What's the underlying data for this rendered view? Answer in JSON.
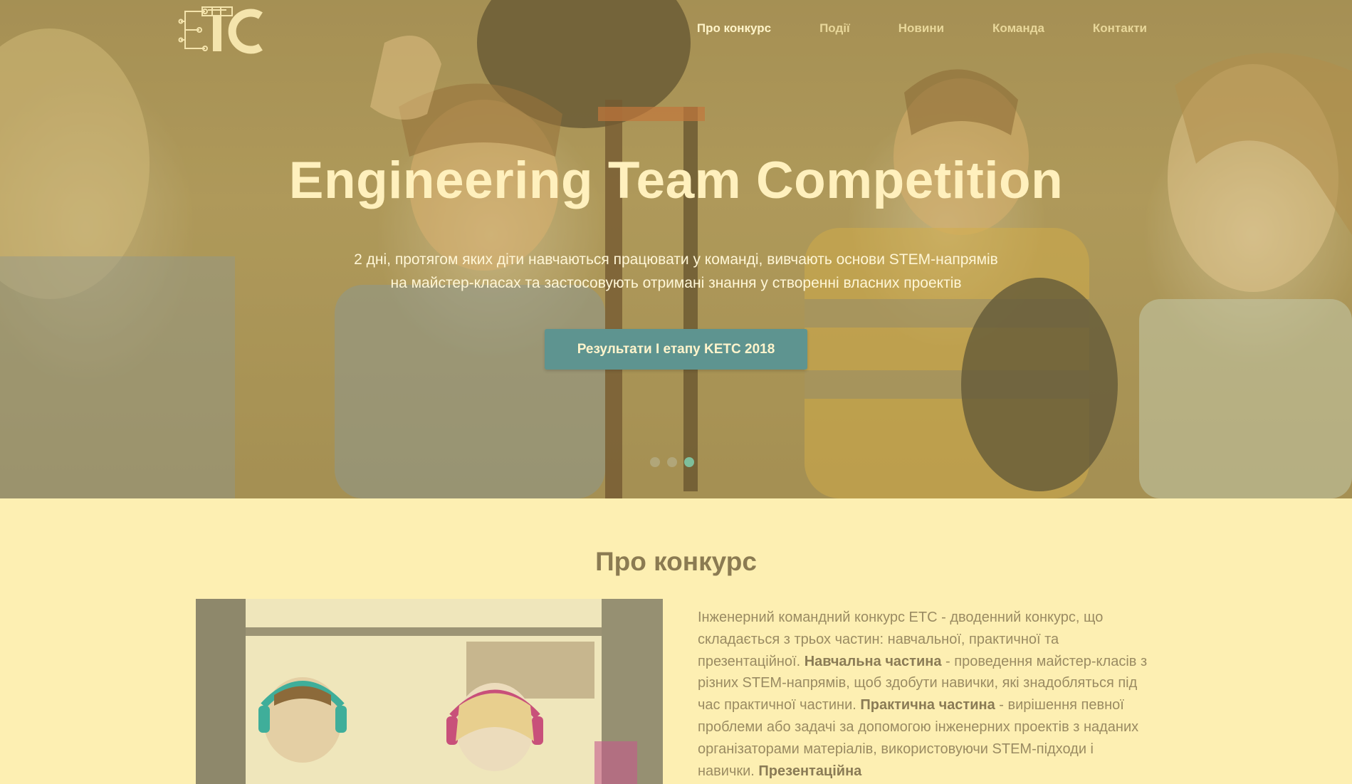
{
  "header": {
    "logo_text": "ETC",
    "nav": [
      {
        "label": "Про конкурс",
        "active": true
      },
      {
        "label": "Події",
        "active": false
      },
      {
        "label": "Новини",
        "active": false
      },
      {
        "label": "Команда",
        "active": false
      },
      {
        "label": "Контакти",
        "active": false
      }
    ]
  },
  "hero": {
    "title": "Engineering Team Competition",
    "subtitle_line1": "2 дні, протягом яких діти навчаються працювати у команді, вивчають основи STEM-напрямів",
    "subtitle_line2": "на майстер-класах та застосовують отримані знання у створенні власних проектів",
    "cta_label": "Результати I етапу KETC 2018",
    "slides": 3,
    "active_slide": 3
  },
  "about": {
    "title": "Про конкурс",
    "p1": "Інженерний командний конкурс ETC - дводенний конкурс, що складається з трьох частин: навчальної, практичної та презентаційної. ",
    "b1": "Навчальна частина",
    "p2": " - проведення майстер-класів з різних STEM-напрямів, щоб здобути навички, які знадобляться під час практичної частини. ",
    "b2": "Практична частина",
    "p3": " - вирішення певної проблеми або задачі за допомогою інженерних проектів з наданих організаторами матеріалів, використовуючи STEM-підходи і навички. ",
    "b3": "Презентаційна"
  },
  "colors": {
    "page_bg": "#fdefb2",
    "cta_bg": "#5e9490",
    "dot_active": "#7ebf9c",
    "heading": "#8b7b52"
  }
}
